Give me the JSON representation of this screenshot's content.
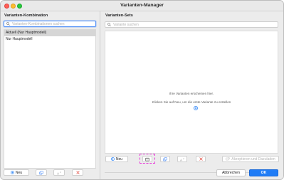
{
  "window": {
    "title": "Varianten-Manager"
  },
  "left": {
    "title": "Varianten-Kombination",
    "search": {
      "placeholder": "Varianten-Kombinationen suchen",
      "icon": "search-icon"
    },
    "items": [
      {
        "label": "Aktuell (Nur Hauptmodell)",
        "selected": true
      },
      {
        "label": "Nur Hauptmodell",
        "selected": false
      }
    ],
    "toolbar": {
      "new_label": "Neu",
      "buttons": [
        {
          "icon": "add-icon",
          "label": "Neu",
          "enabled": true
        },
        {
          "icon": "duplicate-icon",
          "enabled": false
        },
        {
          "icon": "rename-icon",
          "enabled": false
        },
        {
          "icon": "delete-icon",
          "enabled": false
        }
      ]
    }
  },
  "right": {
    "title": "Varianten-Sets",
    "search": {
      "placeholder": "Variante suchen",
      "icon": "search-icon"
    },
    "empty_line1": "Ihre Varianten erscheinen hier.",
    "empty_line2": "Klicken Sie auf Neu, um die erste Variante zu erstellen",
    "toolbar": {
      "new_label": "Neu",
      "apply_label": "Akzeptieren und Dazuladen",
      "buttons": [
        {
          "icon": "add-icon",
          "label": "Neu",
          "enabled": true
        },
        {
          "icon": "capture-icon",
          "enabled": true,
          "highlighted": true
        },
        {
          "icon": "duplicate-icon",
          "enabled": false
        },
        {
          "icon": "rename-icon",
          "enabled": false
        },
        {
          "icon": "delete-icon",
          "enabled": false
        },
        {
          "icon": "apply-icon",
          "label": "Akzeptieren und Dazuladen",
          "enabled": false
        }
      ]
    }
  },
  "footer": {
    "cancel_label": "Abbrechen",
    "ok_label": "OK"
  },
  "colors": {
    "accent": "#1f7cf6",
    "highlight": "#e83ad9",
    "disabled": "#b4b4b4",
    "delete": "#e0483e"
  }
}
